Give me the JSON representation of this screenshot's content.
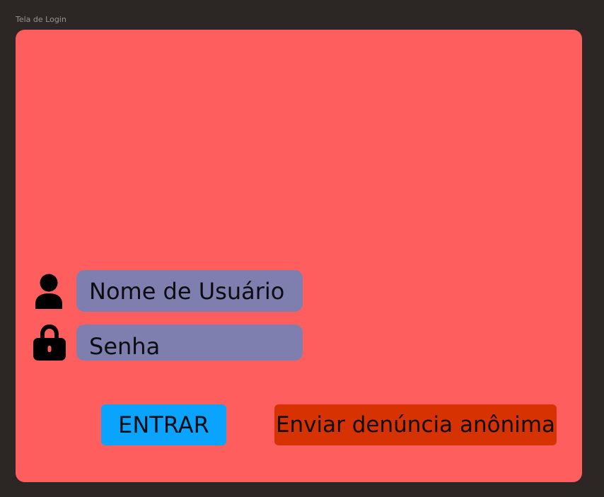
{
  "frame": {
    "label": "Tela de Login"
  },
  "login": {
    "username_field": {
      "placeholder": "Nome de Usuário",
      "icon": "user-icon"
    },
    "password_field": {
      "placeholder": "Senha",
      "icon": "lock-icon"
    },
    "enter_button": "ENTRAR",
    "report_button": "Enviar denúncia anônima"
  },
  "colors": {
    "background": "#2c2624",
    "panel": "#ff5e5e",
    "field": "#7e7fae",
    "enter_button": "#0aa4ff",
    "report_button": "#d73302"
  }
}
